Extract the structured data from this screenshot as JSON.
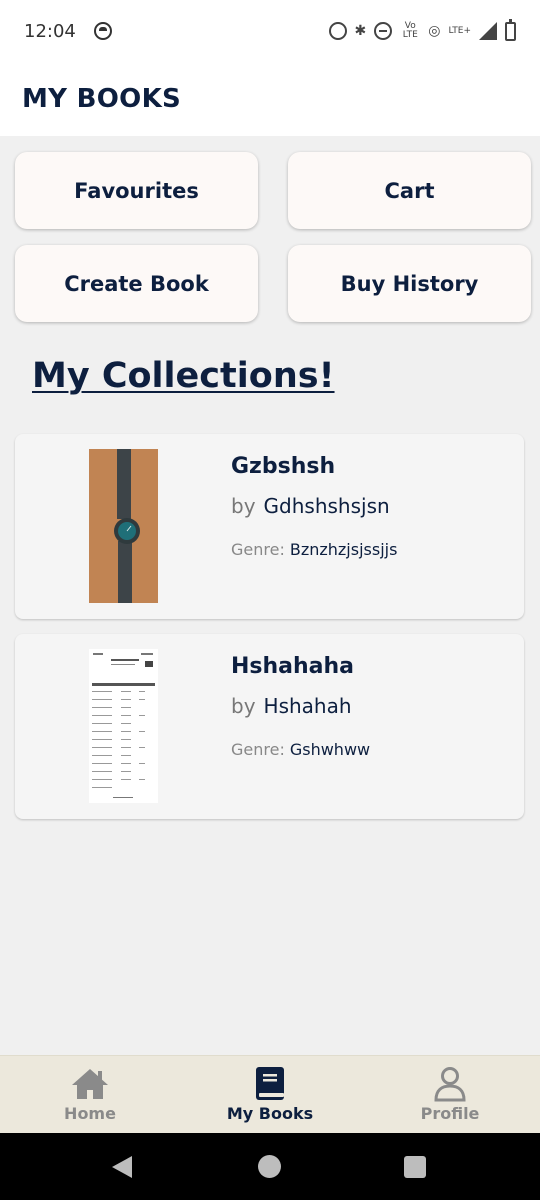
{
  "status_bar": {
    "time": "12:04",
    "icons": [
      "app-notification-icon",
      "alarm-icon",
      "bluetooth-icon",
      "do-not-disturb-icon",
      "volte-icon",
      "hotspot-icon",
      "lte-icon",
      "signal-icon",
      "battery-charging-icon"
    ],
    "volte_label": "Vo LTE",
    "lte_label": "LTE+"
  },
  "app_bar": {
    "title": "MY BOOKS"
  },
  "quick_actions": {
    "favourites": "Favourites",
    "cart": "Cart",
    "create_book": "Create Book",
    "buy_history": "Buy History"
  },
  "collections": {
    "title": "My Collections!",
    "by_label": "by",
    "genre_label": "Genre:",
    "books": [
      {
        "title": "Gzbshsh",
        "author": "Gdhshshsjsn",
        "genre": "Bznzhzjsjssjjs",
        "cover": "wristwatch-photo"
      },
      {
        "title": "Hshahaha",
        "author": "Hshahah",
        "genre": "Gshwhww",
        "cover": "document-table-photo"
      }
    ]
  },
  "bottom_nav": {
    "items": [
      {
        "label": "Home",
        "icon": "home-icon",
        "active": false
      },
      {
        "label": "My Books",
        "icon": "book-icon",
        "active": true
      },
      {
        "label": "Profile",
        "icon": "profile-icon",
        "active": false
      }
    ]
  },
  "colors": {
    "primary": "#0d1f3f",
    "background": "#f0f0f0",
    "tile": "#fdf9f7",
    "nav_bg": "#ece8dc",
    "inactive": "#8a8a8a"
  }
}
